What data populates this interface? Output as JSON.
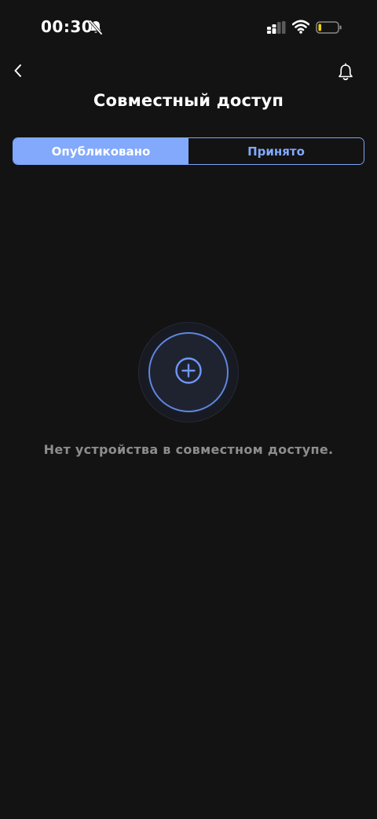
{
  "status_bar": {
    "time": "00:30",
    "icons": [
      "bell-slash-icon",
      "signal-icon",
      "wifi-icon",
      "battery-icon"
    ]
  },
  "header": {
    "title": "Совместный доступ",
    "back_icon": "chevron-left-icon",
    "notification_icon": "bell-icon"
  },
  "tabs": [
    {
      "label": "Опубликовано",
      "active": true
    },
    {
      "label": "Принято",
      "active": false
    }
  ],
  "empty_state": {
    "icon": "plus-circle-icon",
    "message": "Нет устройства в совместном доступе."
  },
  "colors": {
    "background": "#131313",
    "accent": "#82a9fb",
    "accent_ring": "#5f86de",
    "muted_text": "#8d8d8d",
    "battery_low": "#f5d000"
  }
}
